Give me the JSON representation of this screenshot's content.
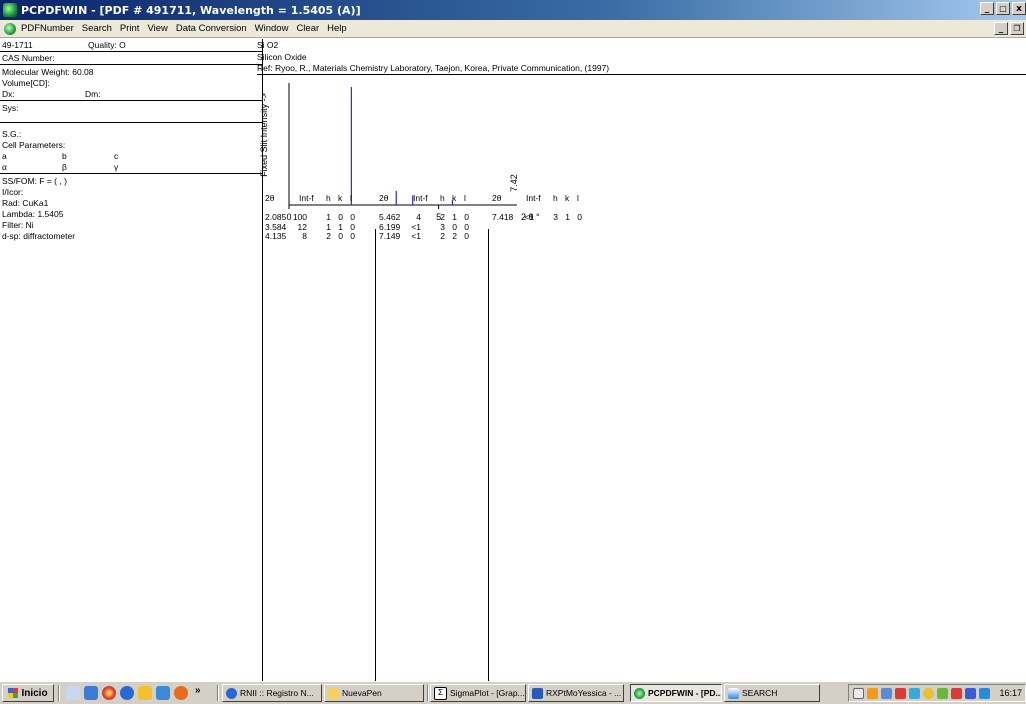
{
  "window": {
    "title": "PCPDFWIN - [PDF # 491711, Wavelength = 1.5405  (A)]",
    "minimize": "_",
    "maximize": "\u0018",
    "close": "x"
  },
  "menu": {
    "items": [
      "PDFNumber",
      "Search",
      "Print",
      "View",
      "Data Conversion",
      "Window",
      "Clear",
      "Help"
    ]
  },
  "card": {
    "pdf_number": "49-1711",
    "quality": "Quality: O",
    "cas": "CAS Number:",
    "mw": "Molecular Weight:  60.08",
    "volume": "Volume[CD]:",
    "dx": "Dx:",
    "dm": "Dm:",
    "sys": "Sys:",
    "sg": "S.G.:",
    "cell": "Cell Parameters:",
    "a": "a",
    "b": "b",
    "c": "c",
    "alpha": "α",
    "beta": "β",
    "gamma": "γ",
    "ssfom": "SS/FOM: F =   (    ,  )",
    "icor": "I/Icor:",
    "rad": "Rad: CuKa1",
    "lambda": "Lambda: 1.5405",
    "filter": "Filter: Ni",
    "dsp": "d-sp: diffractometer",
    "formula": "Si O2",
    "name": "Silicon Oxide",
    "ref": "Ref: Ryoo, R., Materials Chemistry Laboratory, Taejon, Korea, Private Communication, (1997)"
  },
  "table": {
    "headers": {
      "two_theta": "2θ",
      "int": "Int-f",
      "h": "h",
      "k": "k",
      "l": "l"
    },
    "columns": [
      [
        {
          "tt": "2.085",
          "int": "100",
          "h": "1",
          "k": "0",
          "l": "0"
        },
        {
          "tt": "3.584",
          "int": "12",
          "h": "1",
          "k": "1",
          "l": "0"
        },
        {
          "tt": "4.135",
          "int": "8",
          "h": "2",
          "k": "0",
          "l": "0"
        }
      ],
      [
        {
          "tt": "5.462",
          "int": "4",
          "h": "2",
          "k": "1",
          "l": "0"
        },
        {
          "tt": "6.199",
          "int": "<1",
          "h": "3",
          "k": "0",
          "l": "0"
        },
        {
          "tt": "7.149",
          "int": "<1",
          "h": "2",
          "k": "2",
          "l": "0"
        }
      ],
      [
        {
          "tt": "7.418",
          "int": "<1",
          "h": "3",
          "k": "1",
          "l": "0"
        }
      ]
    ]
  },
  "chart_data": {
    "type": "bar",
    "ylabel": "Fixed Slit Intensity ->",
    "xlabel": "2 θ °",
    "x_ticks": [
      "0",
      "5"
    ],
    "end_label": "7.42",
    "xlim": [
      0,
      7.42
    ],
    "ylim": [
      0,
      100
    ],
    "x": [
      2.085,
      3.584,
      4.135,
      5.462,
      6.199,
      7.149,
      7.418
    ],
    "values": [
      100,
      12,
      8,
      4,
      0.5,
      0.5,
      0.5
    ],
    "bar_color": "#2a2ad0"
  },
  "taskbar": {
    "start": "Inicio",
    "chevron": "»",
    "buttons": [
      {
        "label": "RNII :: Registro N..."
      },
      {
        "label": "NuevaPen"
      },
      {
        "label": "SigmaPlot - [Grap..."
      },
      {
        "label": "RXPtMoYessica - ..."
      },
      {
        "label": "PCPDFWIN - [PD..."
      },
      {
        "label": "SEARCH"
      }
    ],
    "clock": "16:17"
  }
}
